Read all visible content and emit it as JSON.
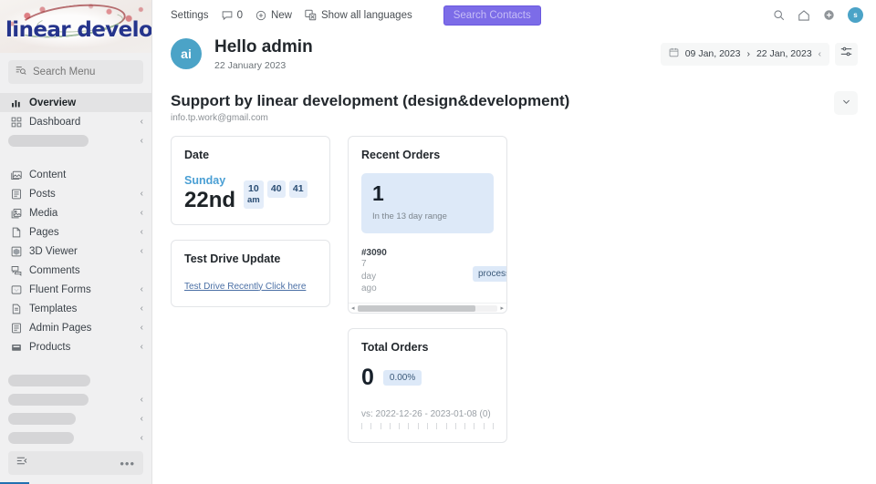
{
  "sidebar": {
    "logo_text": "linear development",
    "search": {
      "placeholder": "Search Menu",
      "icon": "search-menu-icon"
    },
    "items": [
      {
        "label": "Overview",
        "icon": "chart-bars-icon",
        "active": true,
        "chevron": ""
      },
      {
        "label": "Dashboard",
        "icon": "grid-icon",
        "active": false,
        "chevron": "‹"
      },
      {
        "label": "",
        "icon": "",
        "skeleton": true,
        "chevron": "‹",
        "skel_width": 88
      },
      {
        "label": "Content",
        "icon": "gallery-icon",
        "active": false,
        "chevron": ""
      },
      {
        "label": "Posts",
        "icon": "post-icon",
        "active": false,
        "chevron": "‹"
      },
      {
        "label": "Media",
        "icon": "media-icon",
        "active": false,
        "chevron": "‹"
      },
      {
        "label": "Pages",
        "icon": "page-icon",
        "active": false,
        "chevron": "‹"
      },
      {
        "label": "3D Viewer",
        "icon": "cube-icon",
        "active": false,
        "chevron": "‹"
      },
      {
        "label": "Comments",
        "icon": "comments-icon",
        "active": false,
        "chevron": ""
      },
      {
        "label": "Fluent Forms",
        "icon": "form-icon",
        "active": false,
        "chevron": "‹"
      },
      {
        "label": "Templates",
        "icon": "template-icon",
        "active": false,
        "chevron": "‹"
      },
      {
        "label": "Admin Pages",
        "icon": "admin-page-icon",
        "active": false,
        "chevron": "‹"
      },
      {
        "label": "Products",
        "icon": "products-icon",
        "active": false,
        "chevron": "‹"
      },
      {
        "label": "",
        "icon": "",
        "skeleton": true,
        "chevron": "",
        "skel_width": 90
      },
      {
        "label": "",
        "icon": "",
        "skeleton": true,
        "chevron": "‹",
        "skel_width": 88
      },
      {
        "label": "",
        "icon": "",
        "skeleton": true,
        "chevron": "‹",
        "skel_width": 74
      },
      {
        "label": "",
        "icon": "",
        "skeleton": true,
        "chevron": "‹",
        "skel_width": 72
      }
    ],
    "collapse": {
      "icon": "collapse-menu-icon",
      "more_icon": "more-dots-icon"
    }
  },
  "adminbar": {
    "settings_label": "Settings",
    "comments_icon": "comment-bubble-icon",
    "comments_count": "0",
    "new_icon": "plus-circle-icon",
    "new_label": "New",
    "languages_icon": "translate-icon",
    "languages_label": "Show all languages",
    "search_contacts_label": "Search Contacts",
    "search_contacts_color": "#7c6ce8",
    "right_icons": [
      {
        "name": "search-icon",
        "glyph": "⌕"
      },
      {
        "name": "home-icon",
        "glyph": "⌂"
      },
      {
        "name": "plus-circle-icon",
        "glyph": "⊕"
      }
    ],
    "avatar_initial": "s"
  },
  "greeting": {
    "avatar_initials": "ai",
    "title": "Hello admin",
    "subtitle": "22 January 2023",
    "avatar_color": "#4ba3c7",
    "daterange": {
      "calendar_icon": "calendar-icon",
      "start": "09 Jan, 2023",
      "separator": "›",
      "end": "22 Jan, 2023",
      "chevron": "‹",
      "filter_icon": "sliders-icon"
    }
  },
  "section": {
    "title": "Support by linear development (design&development)",
    "subtitle": "info.tp.work@gmail.com",
    "collapse_icon": "chevron-down-icon"
  },
  "cards": {
    "date": {
      "title": "Date",
      "day_of_week": "Sunday",
      "day_number": "22nd",
      "hour": "10",
      "ampm": "am",
      "minute": "40",
      "second": "41"
    },
    "test_drive": {
      "title": "Test Drive Update",
      "link_label": "Test Drive Recently Click here"
    },
    "recent_orders": {
      "title": "Recent Orders",
      "count": "1",
      "range_label": "In the 13 day range",
      "rows": [
        {
          "order_id": "#3090",
          "age_line1": "7",
          "age_line2": "day",
          "age_line3": "ago",
          "status": "processing"
        }
      ],
      "scroll": {
        "left_arrow": "◂",
        "right_arrow": "▸"
      }
    },
    "total_orders": {
      "title": "Total Orders",
      "value": "0",
      "delta": "0.00%",
      "comparison": "vs: 2022-12-26 - 2023-01-08 (0)",
      "tick_count": 15
    }
  }
}
